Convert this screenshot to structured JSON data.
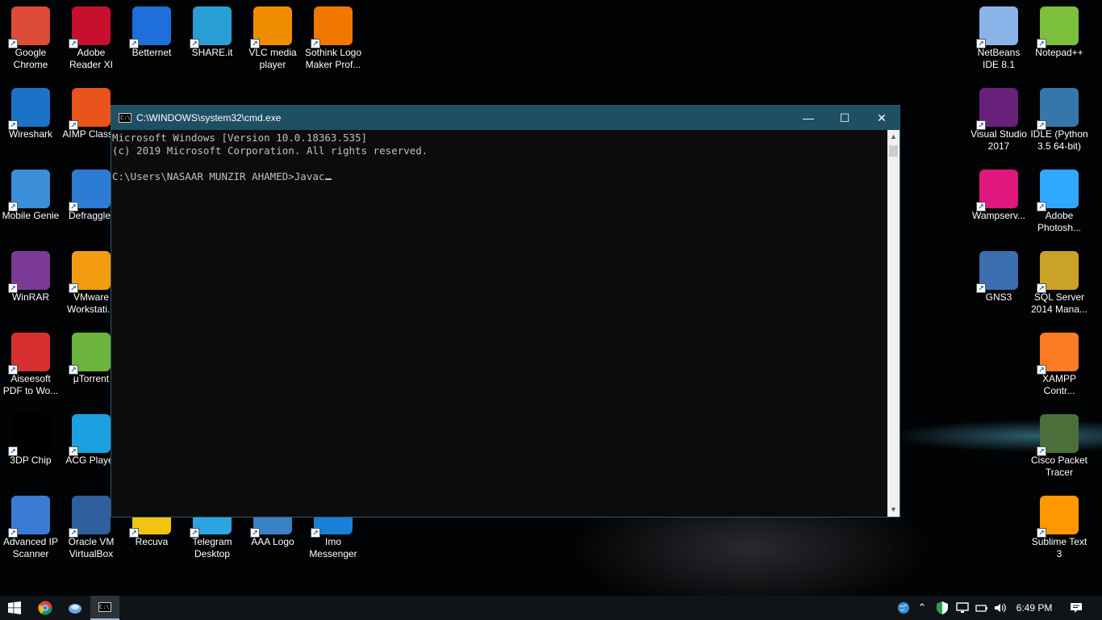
{
  "desktop": {
    "icons": [
      {
        "label": "Google Chrome",
        "icon": "chrome-icon",
        "color": "#dd4b39"
      },
      {
        "label": "Adobe Reader XI",
        "icon": "adobe-reader-icon",
        "color": "#c8102e"
      },
      {
        "label": "Betternet",
        "icon": "betternet-icon",
        "color": "#1e6fd9"
      },
      {
        "label": "SHARE.it",
        "icon": "shareit-icon",
        "color": "#2a9fd6"
      },
      {
        "label": "VLC media player",
        "icon": "vlc-icon",
        "color": "#f08c00"
      },
      {
        "label": "Sothink Logo Maker Prof...",
        "icon": "sothink-icon",
        "color": "#f07800"
      },
      {
        "label": "Wireshark",
        "icon": "wireshark-icon",
        "color": "#1a73c8"
      },
      {
        "label": "AIMP Classic",
        "icon": "aimp-icon",
        "color": "#e8541c"
      },
      {
        "label": "Mobile Genie",
        "icon": "mobile-genie-icon",
        "color": "#3a8fd8"
      },
      {
        "label": "Defraggler",
        "icon": "defraggler-icon",
        "color": "#2d7cd3"
      },
      {
        "label": "WinRAR",
        "icon": "winrar-icon",
        "color": "#7b3a96"
      },
      {
        "label": "VMware Workstati...",
        "icon": "vmware-icon",
        "color": "#f39c12"
      },
      {
        "label": "Aiseesoft PDF to Wo...",
        "icon": "aiseesoft-pdf-icon",
        "color": "#d63031"
      },
      {
        "label": "µTorrent",
        "icon": "utorrent-icon",
        "color": "#6cb33f"
      },
      {
        "label": "3DP Chip",
        "icon": "3dp-chip-icon",
        "color": "#000000"
      },
      {
        "label": "ACG Player",
        "icon": "acg-player-icon",
        "color": "#1ba1e2"
      },
      {
        "label": "Advanced IP Scanner",
        "icon": "advanced-ip-scanner-icon",
        "color": "#3a7bd5"
      },
      {
        "label": "Oracle VM VirtualBox",
        "icon": "virtualbox-icon",
        "color": "#2f5f9c"
      },
      {
        "label": "Recuva",
        "icon": "recuva-icon",
        "color": "#f1c40f"
      },
      {
        "label": "Telegram Desktop",
        "icon": "telegram-icon",
        "color": "#2ca5e0"
      },
      {
        "label": "AAA Logo",
        "icon": "aaa-logo-icon",
        "color": "#3b82c4"
      },
      {
        "label": "Imo Messenger",
        "icon": "imo-icon",
        "color": "#1c7ed6"
      },
      {
        "label": "NetBeans IDE 8.1",
        "icon": "netbeans-icon",
        "color": "#8ab4e8"
      },
      {
        "label": "Notepad++",
        "icon": "notepadpp-icon",
        "color": "#7cbf3c"
      },
      {
        "label": "Visual Studio 2017",
        "icon": "visual-studio-icon",
        "color": "#68217a"
      },
      {
        "label": "IDLE (Python 3.5 64-bit)",
        "icon": "python-idle-icon",
        "color": "#3776ab"
      },
      {
        "label": "Wampserv...",
        "icon": "wampserver-icon",
        "color": "#e0177d"
      },
      {
        "label": "Adobe Photosh...",
        "icon": "photoshop-icon",
        "color": "#31a8ff"
      },
      {
        "label": "GNS3",
        "icon": "gns3-icon",
        "color": "#3c6fb0"
      },
      {
        "label": "SQL Server 2014 Mana...",
        "icon": "sql-server-icon",
        "color": "#c9a227"
      },
      {
        "label": "XAMPP Contr...",
        "icon": "xampp-icon",
        "color": "#fb7a24"
      },
      {
        "label": "Cisco Packet Tracer",
        "icon": "cisco-packet-tracer-icon",
        "color": "#4a6f3a"
      },
      {
        "label": "Sublime Text 3",
        "icon": "sublime-text-icon",
        "color": "#ff9800"
      }
    ]
  },
  "cmd": {
    "title": "C:\\WINDOWS\\system32\\cmd.exe",
    "lines": [
      "Microsoft Windows [Version 10.0.18363.535]",
      "(c) 2019 Microsoft Corporation. All rights reserved.",
      "",
      "C:\\Users\\NASAAR MUNZIR AHAMED>Javac"
    ],
    "minimize": "—",
    "maximize": "☐",
    "close": "✕"
  },
  "taskbar": {
    "clock": "6:49 PM",
    "colors": {
      "background": "#101418",
      "accent": "#9fb4c8"
    }
  }
}
